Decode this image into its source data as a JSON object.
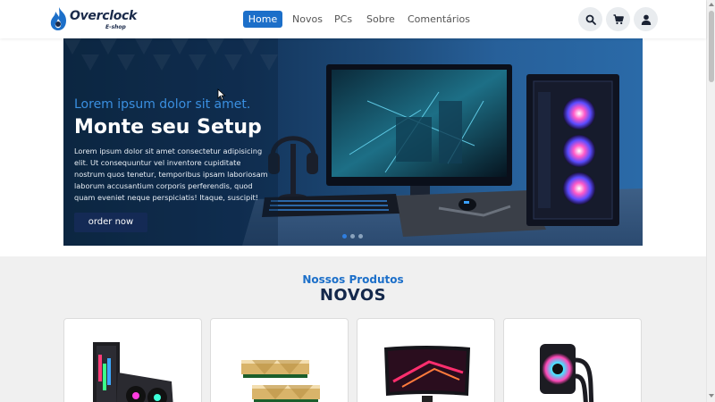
{
  "header": {
    "logo_text": "Overclock",
    "logo_sub": "E-shop",
    "nav": [
      {
        "label": "Home",
        "active": true
      },
      {
        "label": "Novos",
        "active": false
      },
      {
        "label": "PCs",
        "active": false
      },
      {
        "label": "Sobre",
        "active": false
      },
      {
        "label": "Comentários",
        "active": false
      }
    ],
    "icons": [
      "search-icon",
      "cart-icon",
      "user-icon"
    ]
  },
  "hero": {
    "subtitle": "Lorem ipsum dolor sit amet.",
    "title": "Monte seu Setup",
    "text": "Lorem ipsum dolor sit amet consectetur adipisicing elit. Ut consequuntur vel inventore cupiditate nostrum quos tenetur, temporibus ipsam laboriosam laborum accusantium corporis perferendis, quod quam eveniet neque perspiciatis! Itaque, suscipit!",
    "button_label": "order now",
    "slide_count": 3,
    "active_slide": 1
  },
  "products": {
    "subtitle": "Nossos Produtos",
    "title": "NOVOS",
    "items": [
      "graphics-card",
      "ram-modules",
      "curved-monitor",
      "water-cooler"
    ]
  },
  "colors": {
    "accent": "#1c6fc9",
    "dark": "#14284b",
    "button_dark": "#142a55"
  }
}
